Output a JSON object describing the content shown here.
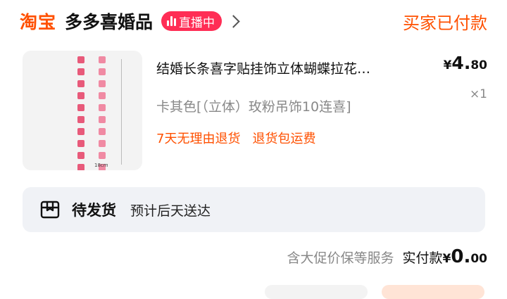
{
  "header": {
    "brand": "淘宝",
    "shop_name": "多多喜婚品",
    "live_badge": "直播中",
    "order_status": "买家已付款"
  },
  "product": {
    "image_icon": "product-thumbnail",
    "image_caption": "18cm",
    "title": "结婚长条喜字贴挂饰立体蝴蝶拉花…",
    "price_symbol": "¥",
    "price_int": "4.",
    "price_dec": "80",
    "quantity": "×1",
    "variant": "卡其色[（立体）玫粉吊饰10连喜]",
    "tags": [
      "7天无理由退货",
      "退货包运费"
    ]
  },
  "shipping": {
    "icon": "package-box-icon",
    "status": "待发货",
    "eta": "预计后天送达"
  },
  "payment": {
    "guarantee": "含大促价保等服务",
    "paid_label": "实付款",
    "paid_symbol": "¥",
    "paid_int": "0.",
    "paid_dec": "00"
  },
  "colors": {
    "accent": "#ff5000",
    "live_badge": "#ff2d55",
    "muted_text": "#888888",
    "shipping_bg": "#f0f2f6"
  }
}
